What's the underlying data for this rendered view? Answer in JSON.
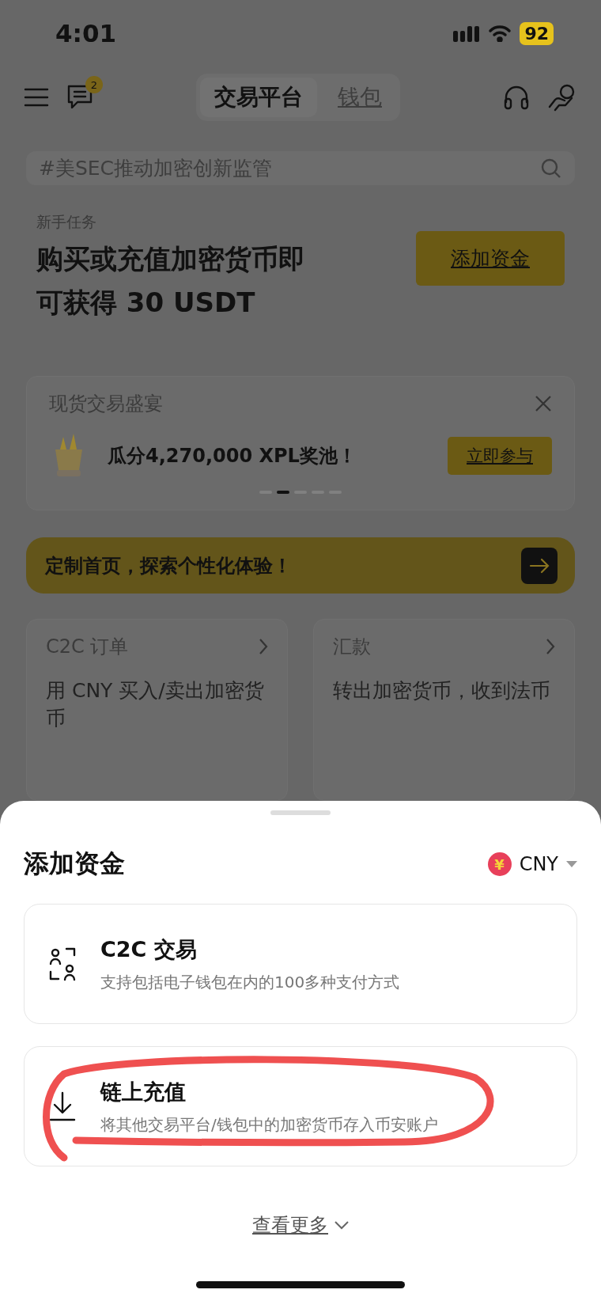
{
  "status_bar": {
    "time": "4:01",
    "battery": "92"
  },
  "header": {
    "message_badge": "2",
    "tabs": [
      {
        "label": "交易平台",
        "selected": true
      },
      {
        "label": "钱包",
        "selected": false
      }
    ]
  },
  "search": {
    "placeholder": "#美SEC推动加密创新监管"
  },
  "task": {
    "label": "新手任务",
    "title": "购买或充值加密货币即可获得 30 USDT",
    "button": "添加资金"
  },
  "promo": {
    "title": "现货交易盛宴",
    "text": "瓜分4,270,000 XPL奖池！",
    "button": "立即参与",
    "dots": [
      {
        "selected": false
      },
      {
        "selected": true
      },
      {
        "selected": false
      },
      {
        "selected": false
      },
      {
        "selected": false
      }
    ]
  },
  "banner": {
    "text": "定制首页，探索个性化体验！"
  },
  "cards": [
    {
      "title": "C2C 订单",
      "text": "用 CNY 买入/卖出加密货币"
    },
    {
      "title": "汇款",
      "text": "转出加密货币，收到法币"
    }
  ],
  "sheet": {
    "title": "添加资金",
    "currency": {
      "symbol": "¥",
      "code": "CNY"
    },
    "options": [
      {
        "kind": "c2c",
        "title": "C2C 交易",
        "text": "支持包括电子钱包在内的100多种支付方式",
        "circled": false
      },
      {
        "kind": "deposit",
        "title": "链上充值",
        "text": "将其他交易平台/钱包中的加密货币存入币安账户",
        "circled": true
      }
    ],
    "more": "查看更多"
  }
}
